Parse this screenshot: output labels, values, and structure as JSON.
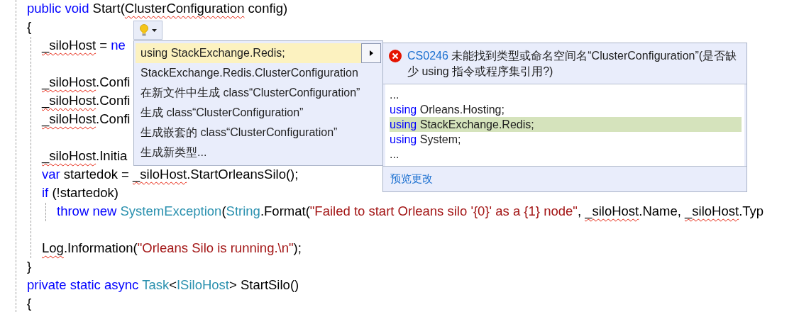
{
  "code": [
    {
      "kind": "code",
      "tokens": [
        {
          "text": "public void ",
          "kind": "keyword"
        },
        {
          "text": "Start(",
          "kind": "plain"
        },
        {
          "text": "ClusterConfiguration",
          "kind": "plain",
          "squiggle": true
        },
        {
          "text": " config)",
          "kind": "plain"
        }
      ]
    },
    {
      "kind": "code",
      "tokens": [
        {
          "text": "{",
          "kind": "plain"
        }
      ],
      "children": [
        {
          "kind": "code",
          "tokens": [
            {
              "text": "_siloHost",
              "kind": "plain",
              "squiggle": true
            },
            {
              "text": " = ",
              "kind": "plain"
            },
            {
              "text": "ne",
              "kind": "keyword"
            }
          ]
        },
        {
          "kind": "blank"
        },
        {
          "kind": "code",
          "tokens": [
            {
              "text": "_siloHost",
              "kind": "plain",
              "squiggle": true
            },
            {
              "text": ".Confi",
              "kind": "plain"
            }
          ]
        },
        {
          "kind": "code",
          "tokens": [
            {
              "text": "_siloHost",
              "kind": "plain",
              "squiggle": true
            },
            {
              "text": ".Confi",
              "kind": "plain"
            }
          ]
        },
        {
          "kind": "code",
          "tokens": [
            {
              "text": "_siloHost",
              "kind": "plain",
              "squiggle": true
            },
            {
              "text": ".Confi",
              "kind": "plain"
            }
          ]
        },
        {
          "kind": "blank"
        },
        {
          "kind": "code",
          "tokens": [
            {
              "text": "_siloHost",
              "kind": "plain",
              "squiggle": true
            },
            {
              "text": ".Initia",
              "kind": "plain"
            }
          ]
        },
        {
          "kind": "code",
          "tokens": [
            {
              "text": "var ",
              "kind": "keyword"
            },
            {
              "text": "startedok = ",
              "kind": "plain"
            },
            {
              "text": "_siloHost",
              "kind": "plain",
              "squiggle": true
            },
            {
              "text": ".StartOrleansSilo();",
              "kind": "plain"
            }
          ]
        },
        {
          "kind": "code",
          "tokens": [
            {
              "text": "if ",
              "kind": "keyword"
            },
            {
              "text": "(!startedok)",
              "kind": "plain"
            }
          ],
          "children": [
            {
              "kind": "code",
              "tokens": [
                {
                  "text": "throw new ",
                  "kind": "keyword"
                },
                {
                  "text": "SystemException",
                  "kind": "type"
                },
                {
                  "text": "(",
                  "kind": "plain"
                },
                {
                  "text": "String",
                  "kind": "type"
                },
                {
                  "text": ".Format(",
                  "kind": "plain"
                },
                {
                  "text": "\"Failed to start Orleans silo '{0}' as a {1} node\"",
                  "kind": "string"
                },
                {
                  "text": ", ",
                  "kind": "plain"
                },
                {
                  "text": "_siloHost",
                  "kind": "plain",
                  "squiggle": true
                },
                {
                  "text": ".Name, ",
                  "kind": "plain"
                },
                {
                  "text": "_siloHost",
                  "kind": "plain",
                  "squiggle": true
                },
                {
                  "text": ".Typ",
                  "kind": "plain"
                }
              ]
            }
          ]
        },
        {
          "kind": "blank"
        },
        {
          "kind": "code",
          "tokens": [
            {
              "text": "Log",
              "kind": "plain",
              "squiggle": true
            },
            {
              "text": ".Information(",
              "kind": "plain"
            },
            {
              "text": "\"Orleans Silo is running.\\n\"",
              "kind": "string"
            },
            {
              "text": ");",
              "kind": "plain"
            }
          ]
        }
      ]
    },
    {
      "kind": "code",
      "tokens": [
        {
          "text": "}",
          "kind": "plain"
        }
      ]
    },
    {
      "kind": "code",
      "tokens": [
        {
          "text": "private static async ",
          "kind": "keyword"
        },
        {
          "text": "Task",
          "kind": "type"
        },
        {
          "text": "<",
          "kind": "plain"
        },
        {
          "text": "ISiloHost",
          "kind": "type"
        },
        {
          "text": "> StartSilo()",
          "kind": "plain"
        }
      ]
    },
    {
      "kind": "code",
      "tokens": [
        {
          "text": "{",
          "kind": "plain"
        }
      ]
    }
  ],
  "quick_actions": {
    "items": [
      {
        "label": "using StackExchange.Redis;",
        "selected": true
      },
      {
        "label": "StackExchange.Redis.ClusterConfiguration",
        "selected": false
      },
      {
        "label": "在新文件中生成 class“ClusterConfiguration”",
        "selected": false
      },
      {
        "label": "生成 class“ClusterConfiguration”",
        "selected": false
      },
      {
        "label": "生成嵌套的 class“ClusterConfiguration”",
        "selected": false
      },
      {
        "label": "生成新类型...",
        "selected": false
      }
    ]
  },
  "preview": {
    "error_code": "CS0246",
    "message": "未能找到类型或命名空间名“ClusterConfiguration”(是否缺少 using 指令或程序集引用?)",
    "lines": [
      {
        "kind": "ellipsis",
        "text": "...",
        "added": false
      },
      {
        "kind": "using",
        "keyword": "using",
        "text": "Orleans.Hosting;",
        "added": false
      },
      {
        "kind": "using",
        "keyword": "using",
        "text": "StackExchange.Redis;",
        "added": true
      },
      {
        "kind": "using",
        "keyword": "using",
        "text": "System;",
        "added": false
      },
      {
        "kind": "ellipsis",
        "text": "...",
        "added": false
      }
    ],
    "link": "预览更改"
  }
}
